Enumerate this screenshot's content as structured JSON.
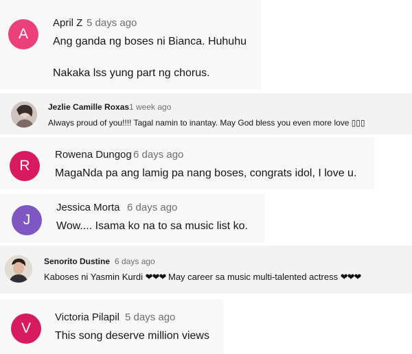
{
  "comments": [
    {
      "name": "April Z",
      "time": "5 days ago",
      "text_lines": [
        "Ang ganda ng boses ni Bianca. Huhuhu",
        "Nakaka lss yung part ng chorus."
      ],
      "avatar_letter": "A",
      "avatar_color": "#ec407a"
    },
    {
      "name": "Jezlie Camille Roxas",
      "time": "1 week ago",
      "text": "Always proud of you!!!! Tagal namin to inantay. May God bless you even more love ▯▯▯",
      "avatar_icon": "profile-photo"
    },
    {
      "name": "Rowena Dungog",
      "time": "6 days ago",
      "text": "MagaNda pa ang lamig pa nang boses, congrats idol, I love u.",
      "avatar_letter": "R",
      "avatar_color": "#d81b60"
    },
    {
      "name": "Jessica Morta",
      "time": "6 days ago",
      "text": "Wow.... Isama ko na to sa music list ko.",
      "avatar_letter": "J",
      "avatar_color": "#7e57c2"
    },
    {
      "name": "Senorito Dustine",
      "time": "6 days ago",
      "text_part1": "Kaboses ni Yasmin Kurdi",
      "hearts1": "❤❤❤",
      "text_part2": "May career sa music multi-talented actress",
      "hearts2": "❤❤❤",
      "avatar_icon": "profile-photo"
    },
    {
      "name": "Victoria Pilapil",
      "time": "5 days ago",
      "text": "This song deserve million views",
      "avatar_letter": "V",
      "avatar_color": "#d81b60"
    }
  ]
}
